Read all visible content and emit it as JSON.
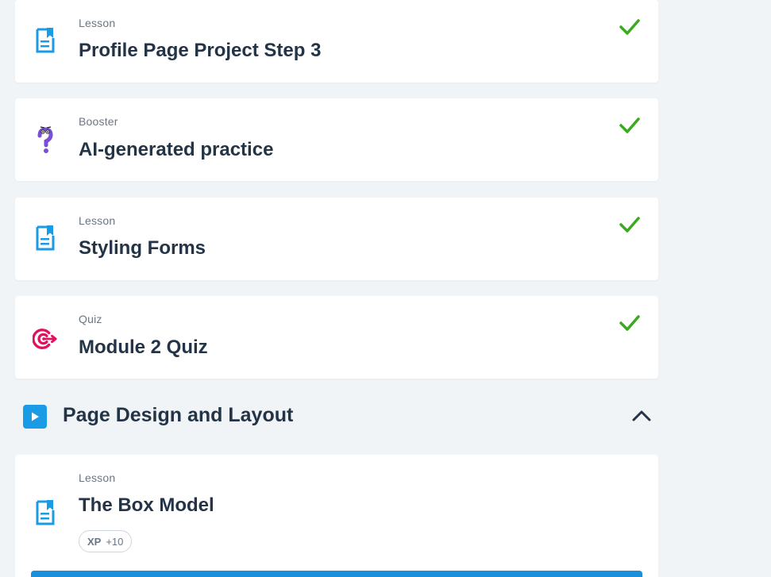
{
  "items": [
    {
      "type": "Lesson",
      "title": "Profile Page Project Step 3",
      "icon": "lesson-doc-icon",
      "completed": true
    },
    {
      "type": "Booster",
      "title": "AI-generated practice",
      "icon": "question-character-icon",
      "completed": true
    },
    {
      "type": "Lesson",
      "title": "Styling Forms",
      "icon": "lesson-doc-icon",
      "completed": true
    },
    {
      "type": "Quiz",
      "title": "Module 2 Quiz",
      "icon": "target-icon",
      "completed": true
    }
  ],
  "section": {
    "title": "Page Design and Layout",
    "icon": "play-icon",
    "expanded": true
  },
  "next_item": {
    "type": "Lesson",
    "title": "The Box Model",
    "xp_label": "XP",
    "xp_value": "+10",
    "icon": "lesson-doc-icon"
  },
  "colors": {
    "accent": "#1a9be6",
    "check": "#3aaa1f",
    "quiz": "#e0115f",
    "booster": "#7a4fd6"
  }
}
